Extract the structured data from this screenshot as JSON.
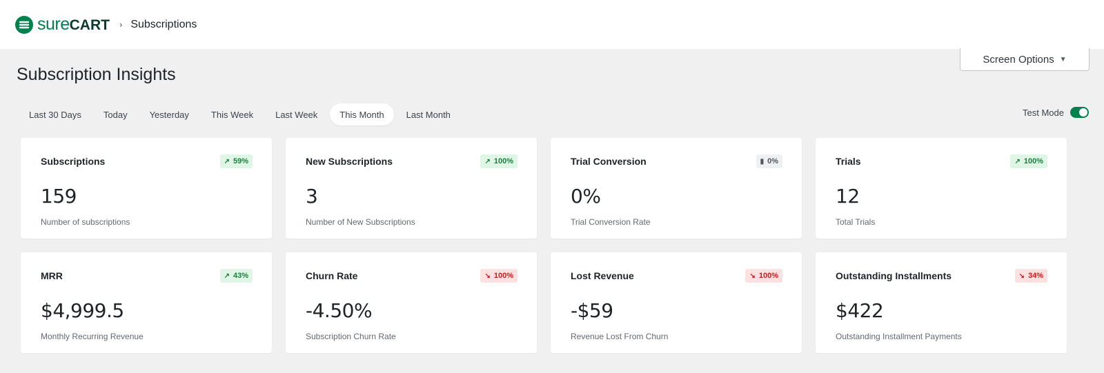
{
  "brand": {
    "name_light": "sure",
    "name_bold": "CART",
    "accent": "#01824c"
  },
  "breadcrumb": {
    "separator": "›",
    "current": "Subscriptions"
  },
  "screen_options": {
    "label": "Screen Options",
    "icon": "caret-down-icon"
  },
  "page": {
    "title": "Subscription Insights"
  },
  "filters": [
    {
      "label": "Last 30 Days",
      "active": false
    },
    {
      "label": "Today",
      "active": false
    },
    {
      "label": "Yesterday",
      "active": false
    },
    {
      "label": "This Week",
      "active": false
    },
    {
      "label": "Last Week",
      "active": false
    },
    {
      "label": "This Month",
      "active": true
    },
    {
      "label": "Last Month",
      "active": false
    }
  ],
  "test_mode": {
    "label": "Test Mode",
    "enabled": true
  },
  "cards": [
    {
      "title": "Subscriptions",
      "value": "159",
      "desc": "Number of subscriptions",
      "badge": "59%",
      "trend": "up",
      "trend_symbol": "↗"
    },
    {
      "title": "New Subscriptions",
      "value": "3",
      "desc": "Number of New Subscriptions",
      "badge": "100%",
      "trend": "up",
      "trend_symbol": "↗"
    },
    {
      "title": "Trial Conversion",
      "value": "0%",
      "desc": "Trial Conversion Rate",
      "badge": "0%",
      "trend": "flat",
      "trend_symbol": "▮"
    },
    {
      "title": "Trials",
      "value": "12",
      "desc": "Total Trials",
      "badge": "100%",
      "trend": "up",
      "trend_symbol": "↗"
    },
    {
      "title": "MRR",
      "value": "$4,999.5",
      "desc": "Monthly Recurring Revenue",
      "badge": "43%",
      "trend": "up",
      "trend_symbol": "↗"
    },
    {
      "title": "Churn Rate",
      "value": "-4.50%",
      "desc": "Subscription Churn Rate",
      "badge": "100%",
      "trend": "down",
      "trend_symbol": "↘"
    },
    {
      "title": "Lost Revenue",
      "value": "-$59",
      "desc": "Revenue Lost From Churn",
      "badge": "100%",
      "trend": "down",
      "trend_symbol": "↘"
    },
    {
      "title": "Outstanding Installments",
      "value": "$422",
      "desc": "Outstanding Installment Payments",
      "badge": "34%",
      "trend": "down",
      "trend_symbol": "↘"
    }
  ]
}
